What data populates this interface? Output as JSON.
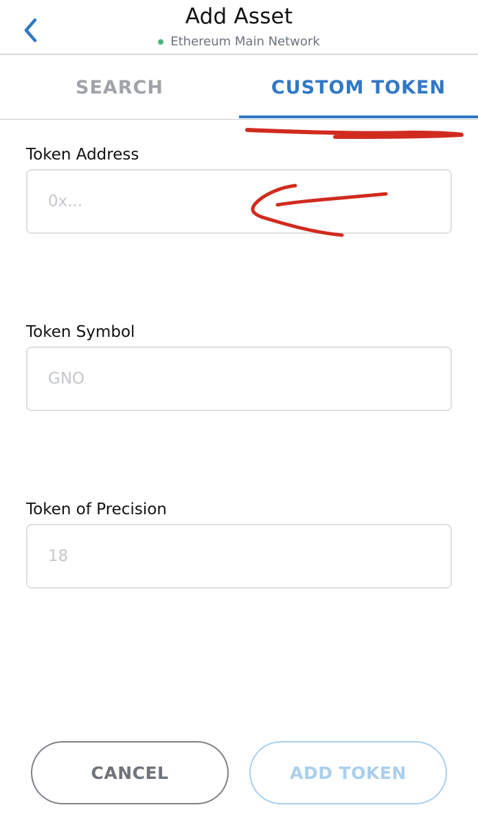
{
  "header": {
    "title": "Add Asset",
    "network": "Ethereum Main Network",
    "network_status_color": "#4cb682",
    "back_icon": "chevron-left-icon"
  },
  "tabs": [
    {
      "label": "SEARCH",
      "active": false
    },
    {
      "label": "CUSTOM TOKEN",
      "active": true
    }
  ],
  "colors": {
    "accent": "#3078c6",
    "annotation": "#d12b1f"
  },
  "form": {
    "token_address": {
      "label": "Token Address",
      "placeholder": "0x...",
      "value": ""
    },
    "token_symbol": {
      "label": "Token Symbol",
      "placeholder": "GNO",
      "value": ""
    },
    "token_precision": {
      "label": "Token of Precision",
      "placeholder": "18",
      "value": ""
    }
  },
  "buttons": {
    "cancel": "CANCEL",
    "add_token": "ADD TOKEN"
  }
}
